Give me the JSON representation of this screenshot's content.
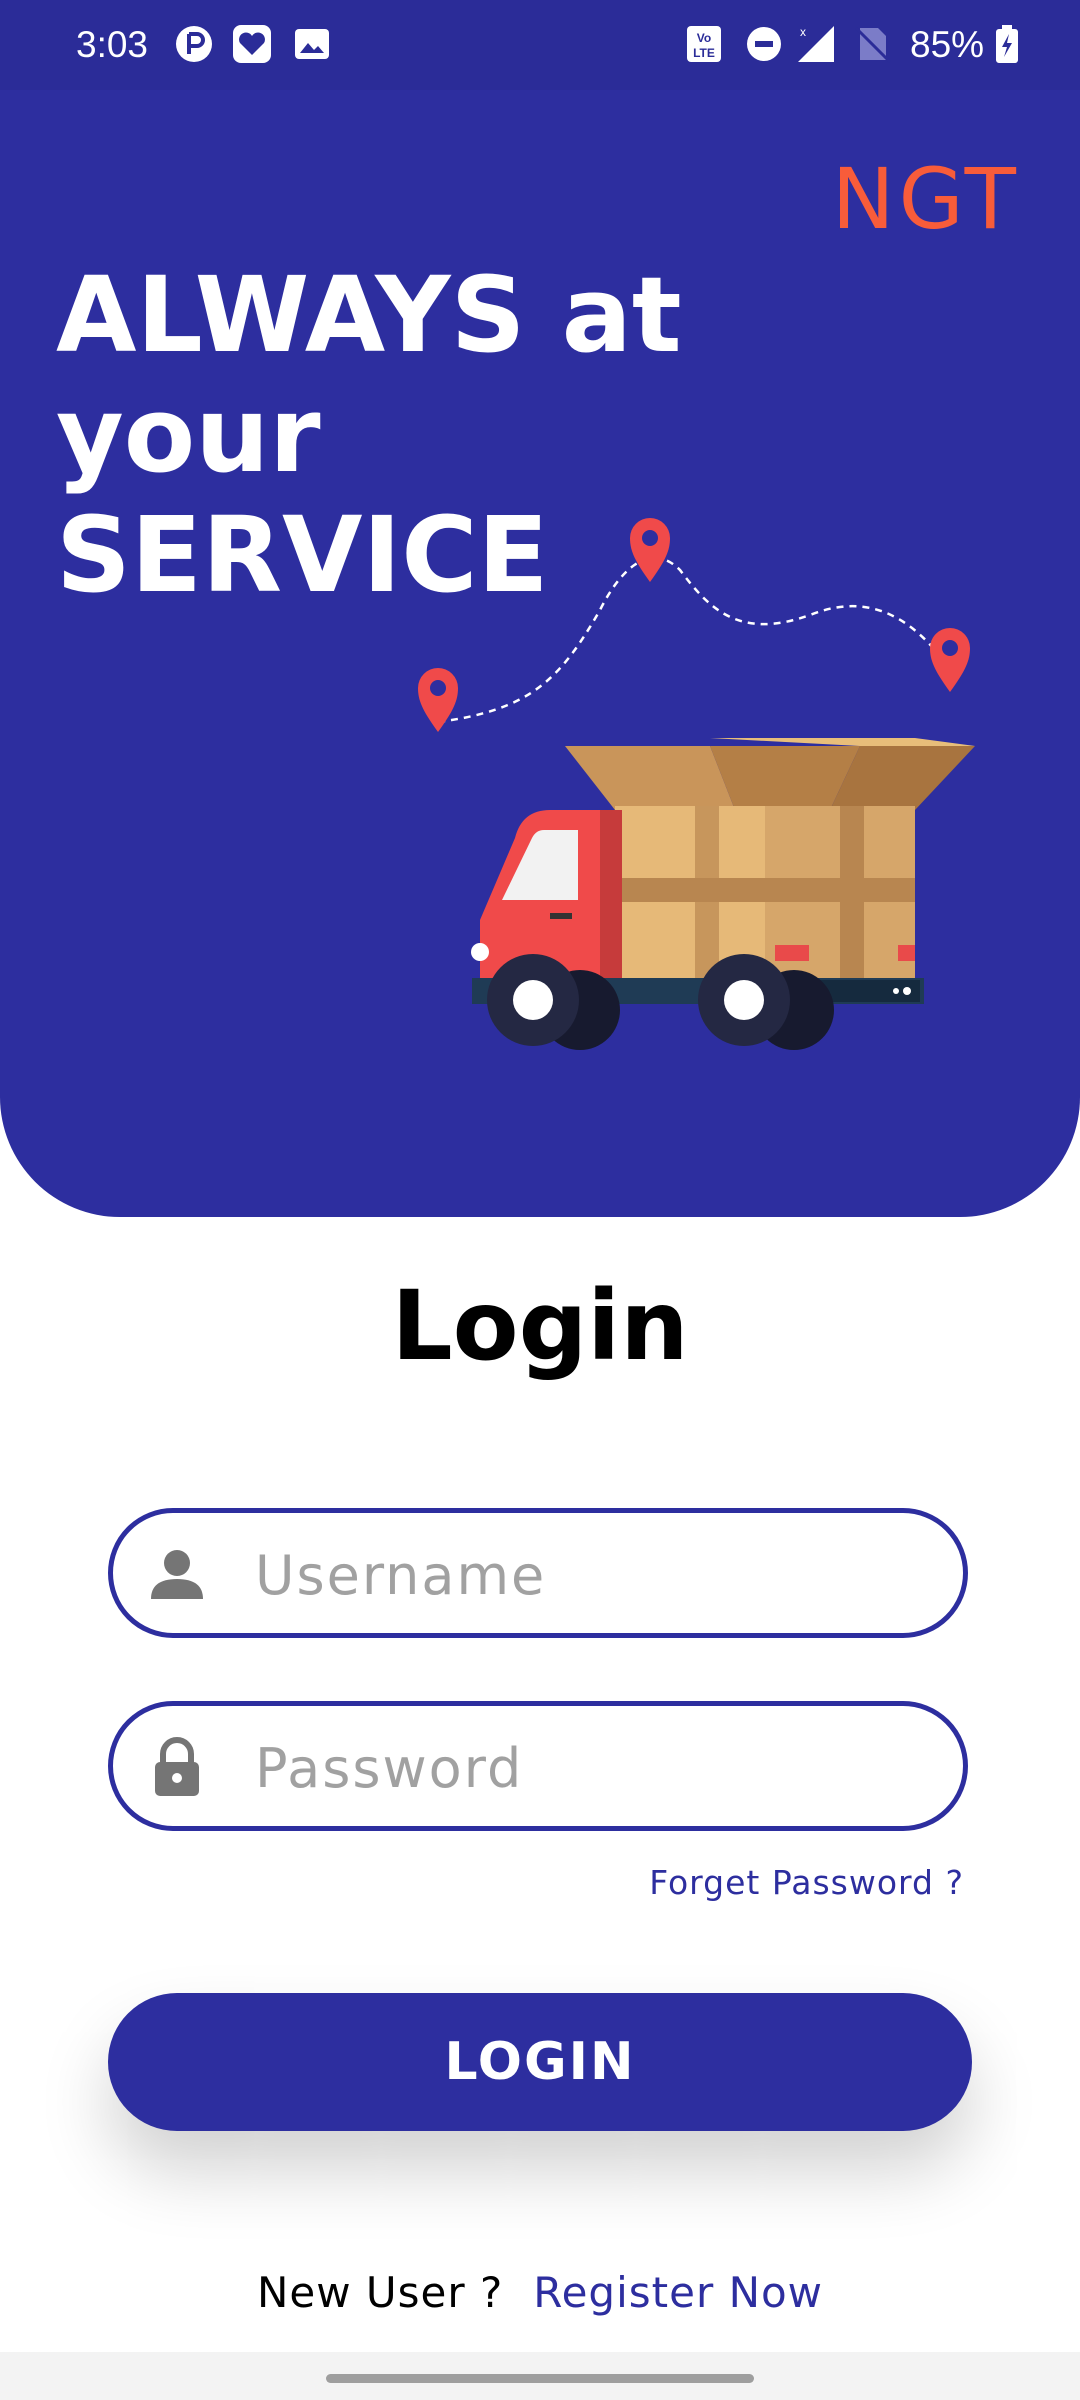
{
  "status_bar": {
    "time": "3:03",
    "battery": "85%",
    "icons": [
      "notification-p-icon",
      "heart-icon",
      "image-icon",
      "volte-icon",
      "dnd-icon",
      "signal-icon",
      "no-sim-icon",
      "battery-charging-icon"
    ]
  },
  "hero": {
    "brand": "NGT",
    "headline": "ALWAYS at your SERVICE"
  },
  "form": {
    "title": "Login",
    "username_placeholder": "Username",
    "password_placeholder": "Password",
    "forgot_label": "Forget Password ?",
    "login_label": "LOGIN",
    "new_user_label": "New User ?",
    "register_label": "Register Now"
  },
  "colors": {
    "primary": "#2d2e9f",
    "accent": "#f85c3a",
    "pin": "#f04a4a"
  }
}
